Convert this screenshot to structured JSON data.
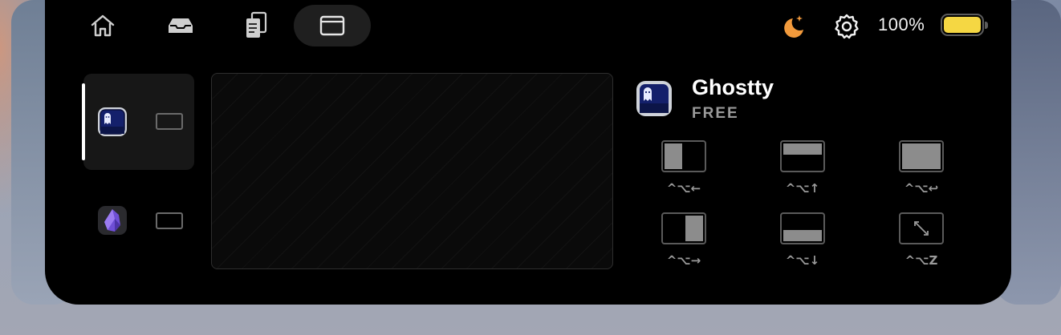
{
  "toolbar": {
    "tabs": [
      {
        "name": "home",
        "icon": "house-icon",
        "active": false
      },
      {
        "name": "tray",
        "icon": "tray-icon",
        "active": false
      },
      {
        "name": "files",
        "icon": "documents-icon",
        "active": false
      },
      {
        "name": "windows",
        "icon": "window-icon",
        "active": true
      }
    ]
  },
  "status": {
    "night_icon": "moon-stars-icon",
    "settings_icon": "gear-icon",
    "battery_text": "100%",
    "battery_level": 1.0,
    "battery_color": "#f5d743",
    "moon_color": "#f29a3c"
  },
  "windows": [
    {
      "app": "ghostty",
      "icon": "ghostty-icon",
      "selected": true
    },
    {
      "app": "obsidian",
      "icon": "obsidian-icon",
      "selected": false
    }
  ],
  "detail": {
    "app_name": "Ghostty",
    "plan": "FREE",
    "layouts": [
      {
        "name": "left-half",
        "shortcut": "^⌥←"
      },
      {
        "name": "top-half",
        "shortcut": "^⌥↑"
      },
      {
        "name": "fill",
        "shortcut": "^⌥↩"
      },
      {
        "name": "right-half",
        "shortcut": "^⌥→"
      },
      {
        "name": "bottom-half",
        "shortcut": "^⌥↓"
      },
      {
        "name": "restore",
        "shortcut": "^⌥Z"
      }
    ]
  }
}
